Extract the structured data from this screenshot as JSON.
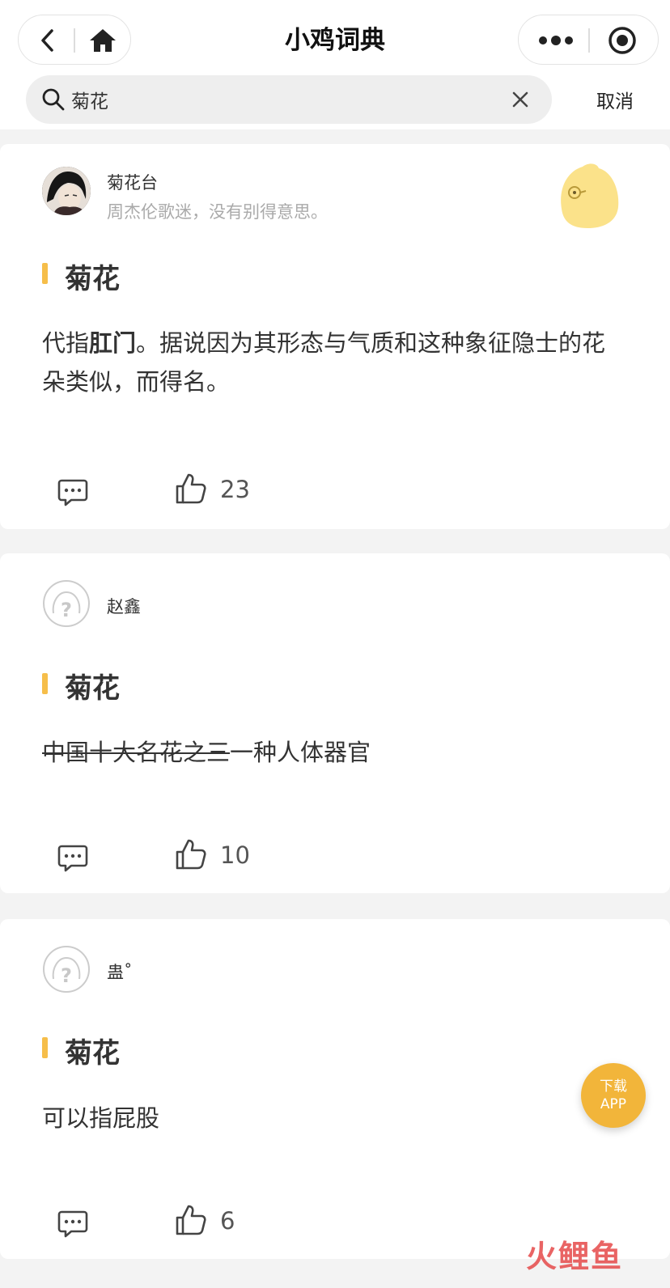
{
  "nav": {
    "title": "小鸡词典"
  },
  "search": {
    "value": "菊花",
    "cancel_label": "取消"
  },
  "entries": [
    {
      "user": "菊花台",
      "signature": "周杰伦歌迷，没有别得意思。",
      "word": "菊花",
      "definition_plain_1": "代指",
      "definition_bold": "肛门",
      "definition_plain_2": "。据说因为其形态与气质和这种象征隐士的花朵类似，而得名。",
      "likes": "23"
    },
    {
      "user": "赵鑫",
      "word": "菊花",
      "definition_struck": "中国十大名花之三",
      "definition_plain": "一种人体器官",
      "likes": "10"
    },
    {
      "user": "蛊˚",
      "word": "菊花",
      "definition_plain": "可以指屁股",
      "likes": "6"
    }
  ],
  "fab": {
    "line1": "下载",
    "line2": "APP"
  },
  "watermark": "火鲤鱼",
  "colors": {
    "accent": "#f6be4a",
    "fab": "#f2b53a",
    "watermark": "#e64a4a"
  },
  "icons": {
    "back": "chevron-left-icon",
    "home": "home-icon",
    "more": "more-dots-icon",
    "target": "target-icon",
    "search": "search-icon",
    "clear": "close-icon",
    "comment": "comment-icon",
    "like": "thumbs-up-icon"
  }
}
